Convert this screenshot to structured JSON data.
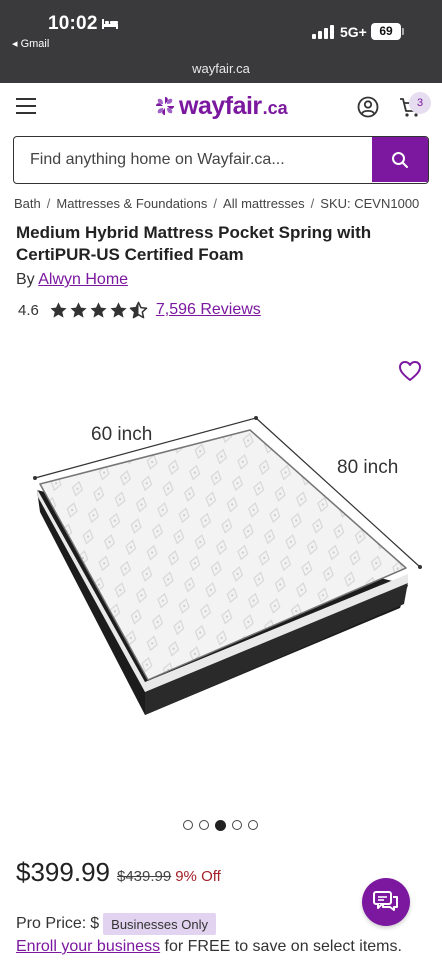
{
  "status_bar": {
    "time": "10:02",
    "back_label": "◂ Gmail",
    "network": "5G+",
    "battery": "69"
  },
  "browser": {
    "url": "wayfair.ca"
  },
  "header": {
    "logo_text": "wayfair",
    "logo_suffix": ".ca",
    "cart_count": "3"
  },
  "search": {
    "placeholder": "Find anything home on Wayfair.ca..."
  },
  "breadcrumb": {
    "items": [
      "Bath",
      "Mattresses & Foundations",
      "All mattresses",
      "SKU: CEVN1000"
    ]
  },
  "product": {
    "title": "Medium Hybrid Mattress Pocket Spring with CertiPUR-US Certified Foam",
    "by_prefix": "By",
    "brand": "Alwyn Home",
    "rating": "4.6",
    "stars_filled": 4.5,
    "reviews_label": "7,596 Reviews",
    "image_labels": {
      "width": "60 inch",
      "length": "80 inch"
    },
    "image_count": 5,
    "active_image_index": 2
  },
  "pricing": {
    "price": "$399.99",
    "was_price": "$439.99",
    "discount": "9% Off",
    "pro_label": "Pro Price:",
    "pro_dollar": "$",
    "business_badge": "Businesses Only",
    "enroll_link": "Enroll your business",
    "enroll_text": " for FREE to save on select items."
  },
  "colors": {
    "brand_purple": "#7b189f",
    "discount_red": "#a3212a",
    "status_bar_bg": "#3a3a3c"
  }
}
